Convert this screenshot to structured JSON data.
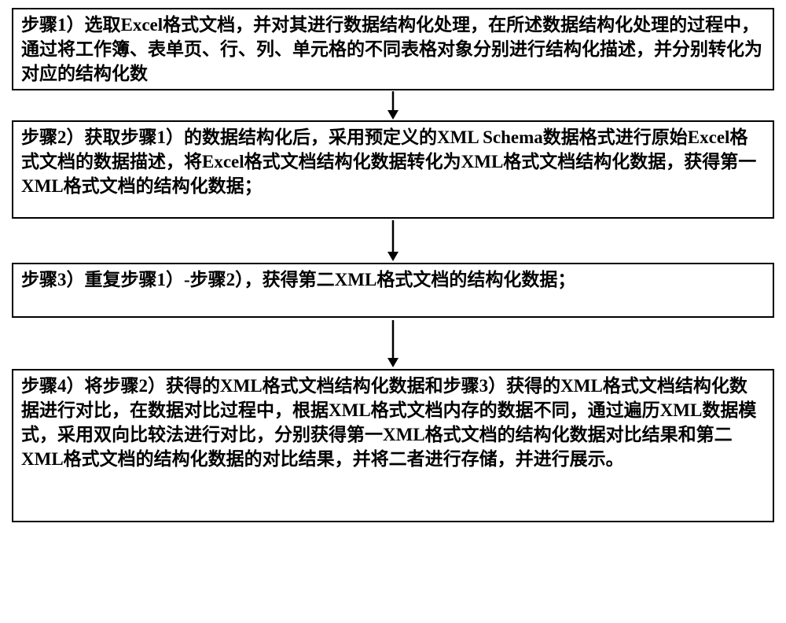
{
  "flowchart": {
    "steps": [
      {
        "id": "step1",
        "text": "步骤1）选取Excel格式文档，并对其进行数据结构化处理，在所述数据结构化处理的过程中，通过将工作簿、表单页、行、列、单元格的不同表格对象分别进行结构化描述，并分别转化为对应的结构化数"
      },
      {
        "id": "step2",
        "text": "步骤2）获取步骤1）的数据结构化后，采用预定义的XML Schema数据格式进行原始Excel格式文档的数据描述，将Excel格式文档结构化数据转化为XML格式文档结构化数据，获得第一XML格式文档的结构化数据；"
      },
      {
        "id": "step3",
        "text": "步骤3）重复步骤1）-步骤2），获得第二XML格式文档的结构化数据；"
      },
      {
        "id": "step4",
        "text": "步骤4）将步骤2）获得的XML格式文档结构化数据和步骤3）获得的XML格式文档结构化数据进行对比，在数据对比过程中，根据XML格式文档内存的数据不同，通过遍历XML数据模式，采用双向比较法进行对比，分别获得第一XML格式文档的结构化数据对比结果和第二XML格式文档的结构化数据的对比结果，并将二者进行存储，并进行展示。"
      }
    ]
  }
}
